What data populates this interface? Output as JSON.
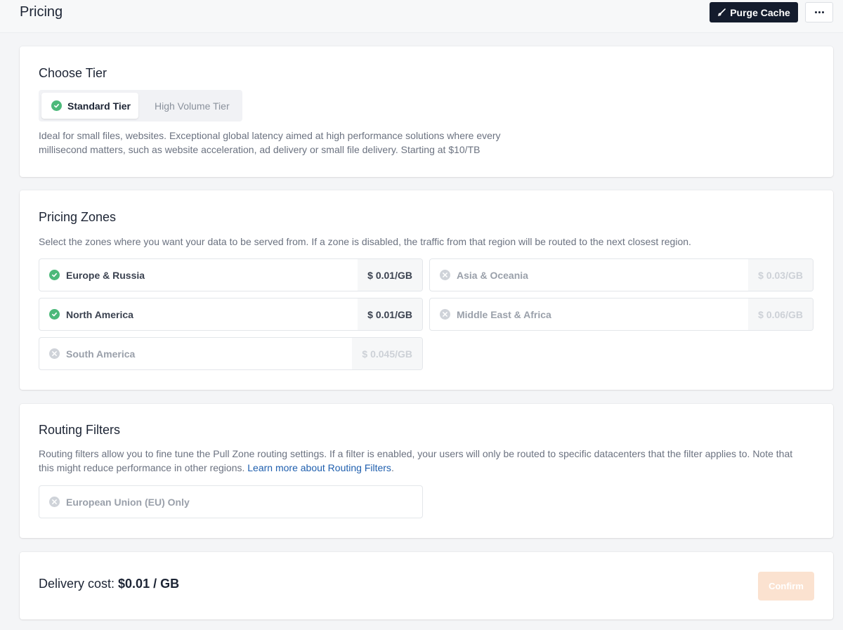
{
  "header": {
    "title": "Pricing",
    "purge_label": "Purge Cache"
  },
  "tier": {
    "title": "Choose Tier",
    "options": [
      {
        "label": "Standard Tier",
        "selected": true
      },
      {
        "label": "High Volume Tier",
        "selected": false
      }
    ],
    "description_line1": "Ideal for small files, websites. Exceptional global latency aimed at high performance solutions where every",
    "description_line2": "millisecond matters, such as website acceleration, ad delivery or small file delivery. Starting at $10/TB"
  },
  "zones": {
    "title": "Pricing Zones",
    "description": "Select the zones where you want your data to be served from. If a zone is disabled, the traffic from that region will be routed to the next closest region.",
    "items": [
      {
        "name": "Europe & Russia",
        "price": "$ 0.01/GB",
        "enabled": true
      },
      {
        "name": "Asia & Oceania",
        "price": "$ 0.03/GB",
        "enabled": false
      },
      {
        "name": "North America",
        "price": "$ 0.01/GB",
        "enabled": true
      },
      {
        "name": "Middle East & Africa",
        "price": "$ 0.06/GB",
        "enabled": false
      },
      {
        "name": "South America",
        "price": "$ 0.045/GB",
        "enabled": false
      }
    ]
  },
  "routing": {
    "title": "Routing Filters",
    "description_line1": "Routing filters allow you to fine tune the Pull Zone routing settings. If a filter is enabled, your users will only be routed to specific datacenters that the filter applies to. Note that",
    "description_line2_prefix": "this might reduce performance in other regions. ",
    "link_text": "Learn more about Routing Filters",
    "description_line2_suffix": ".",
    "filters": [
      {
        "name": "European Union (EU) Only",
        "enabled": false
      }
    ]
  },
  "footer": {
    "delivery_label": "Delivery cost: ",
    "delivery_value": "$0.01 / GB",
    "confirm_label": "Confirm"
  },
  "colors": {
    "accent_green": "#4cb97a",
    "dark_button": "#141c2d",
    "confirm_disabled": "#fbe2d0",
    "link": "#1f5fae"
  }
}
